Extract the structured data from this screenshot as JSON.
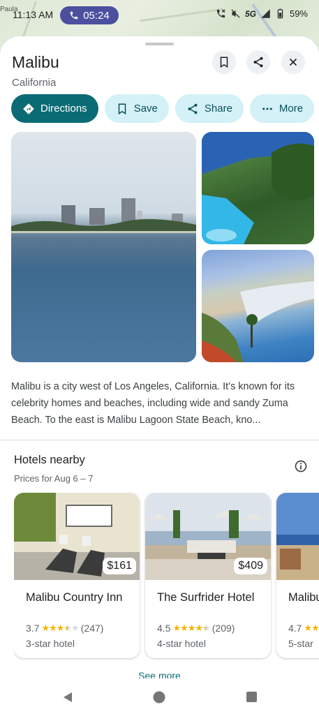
{
  "status_bar": {
    "map_label": "Paula",
    "time": "11:13 AM",
    "call_timer": "05:24",
    "network": "5G",
    "battery": "59%"
  },
  "place": {
    "name": "Malibu",
    "region": "California"
  },
  "actions": {
    "directions": "Directions",
    "save": "Save",
    "share": "Share",
    "more": "More"
  },
  "description": "Malibu is a city west of Los Angeles, California. It’s known for its celebrity homes and beaches, including wide and sandy Zuma Beach. To the east is Malibu Lagoon State Beach, kno...",
  "hotels": {
    "title": "Hotels nearby",
    "subtitle": "Prices for Aug 6 – 7",
    "see_more": "See more",
    "items": [
      {
        "name": "Malibu Country Inn",
        "price": "$161",
        "rating": "3.7",
        "reviews": "(247)",
        "hotel_class": "3-star hotel"
      },
      {
        "name": "The Surfrider Hotel",
        "price": "$409",
        "rating": "4.5",
        "reviews": "(209)",
        "hotel_class": "4-star hotel"
      },
      {
        "name": "Malibu",
        "rating": "4.7",
        "hotel_class": "5-star"
      }
    ]
  },
  "colors": {
    "accent": "#0b6b74",
    "chip_bg": "#d3f1f7",
    "call_pill": "#4b4f9e",
    "star": "#f4b400"
  },
  "icons": {
    "call": "phone-icon",
    "directions": "directions-icon",
    "save": "bookmark-icon",
    "share": "share-icon",
    "more": "more-horiz-icon",
    "close": "close-icon",
    "info": "info-icon"
  }
}
